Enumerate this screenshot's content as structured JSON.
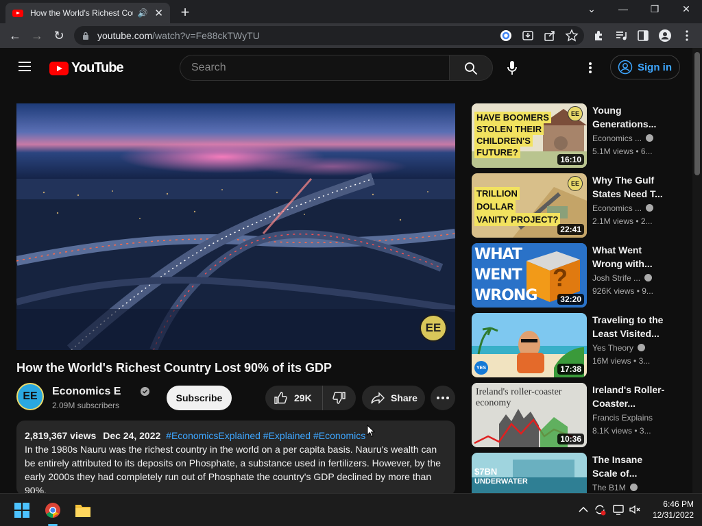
{
  "browser": {
    "tab_title": "How the World's Richest Cou",
    "url_host": "youtube.com",
    "url_path": "/watch?v=Fe88ckTWyTU"
  },
  "masthead": {
    "logo_text": "YouTube",
    "search_placeholder": "Search",
    "sign_in_label": "Sign in"
  },
  "video": {
    "watermark": "EE",
    "title": "How the World's Richest Country Lost 90% of its GDP",
    "channel_name": "Economics Expl...",
    "channel_avatar": "EE",
    "subscribers": "2.09M subscribers",
    "subscribe_label": "Subscribe",
    "likes": "29K",
    "share_label": "Share"
  },
  "description": {
    "views": "2,819,367 views",
    "date": "Dec 24, 2022",
    "hashtags": "#EconomicsExplained #Explained #Economics",
    "text": "In the 1980s Nauru was the richest country in the world on a per capita basis. Nauru's wealth can be entirely attributed to its deposits on Phosphate, a substance used in fertilizers. However, by the early 2000s they had completely run out of Phosphate the country's GDP declined by more than 90%."
  },
  "recommendations": [
    {
      "title": "Young Generations...",
      "channel": "Economics ...",
      "verified": true,
      "views": "5.1M views",
      "age": "6...",
      "duration": "16:10",
      "thumb_text": "HAVE BOOMERS STOLEN THEIR CHILDREN'S FUTURE?",
      "thumb_line1": "HAVE BOOMERS",
      "thumb_line2": "STOLEN THEIR",
      "thumb_line3": "CHILDREN'S",
      "thumb_line4": "FUTURE?",
      "badge": "EE"
    },
    {
      "title": "Why The Gulf States Need T...",
      "channel": "Economics ...",
      "verified": true,
      "views": "2.1M views",
      "age": "2...",
      "duration": "22:41",
      "thumb_line1": "TRILLION",
      "thumb_line2": "DOLLAR",
      "thumb_line3": "VANITY PROJECT?",
      "badge": "EE"
    },
    {
      "title": "What Went Wrong with...",
      "channel": "Josh Strife ...",
      "verified": true,
      "views": "926K views",
      "age": "9...",
      "duration": "32:20",
      "thumb_line1": "WHAT",
      "thumb_line2": "WENT",
      "thumb_line3": "WRONG",
      "thumb_mark": "?"
    },
    {
      "title": "Traveling to the Least Visited...",
      "channel": "Yes Theory",
      "verified": true,
      "views": "16M views",
      "age": "3...",
      "duration": "17:38",
      "badge": "YES"
    },
    {
      "title": "Ireland's Roller-Coaster...",
      "channel": "Francis Explains",
      "verified": false,
      "views": "8.1K views",
      "age": "3...",
      "duration": "10:36",
      "thumb_line1": "Ireland's roller-coaster",
      "thumb_line2": "economy"
    },
    {
      "title": "The Insane Scale of...",
      "channel": "The B1M",
      "verified": true,
      "views": "",
      "age": "",
      "duration": "",
      "thumb_line1": "$7BN",
      "thumb_line2": "UNDERWATER"
    }
  ],
  "taskbar": {
    "time": "6:46 PM",
    "date": "12/31/2022"
  },
  "colors": {
    "youtube_red": "#ff0000",
    "link_blue": "#3ea6ff",
    "page_bg": "#0f0f0f"
  }
}
